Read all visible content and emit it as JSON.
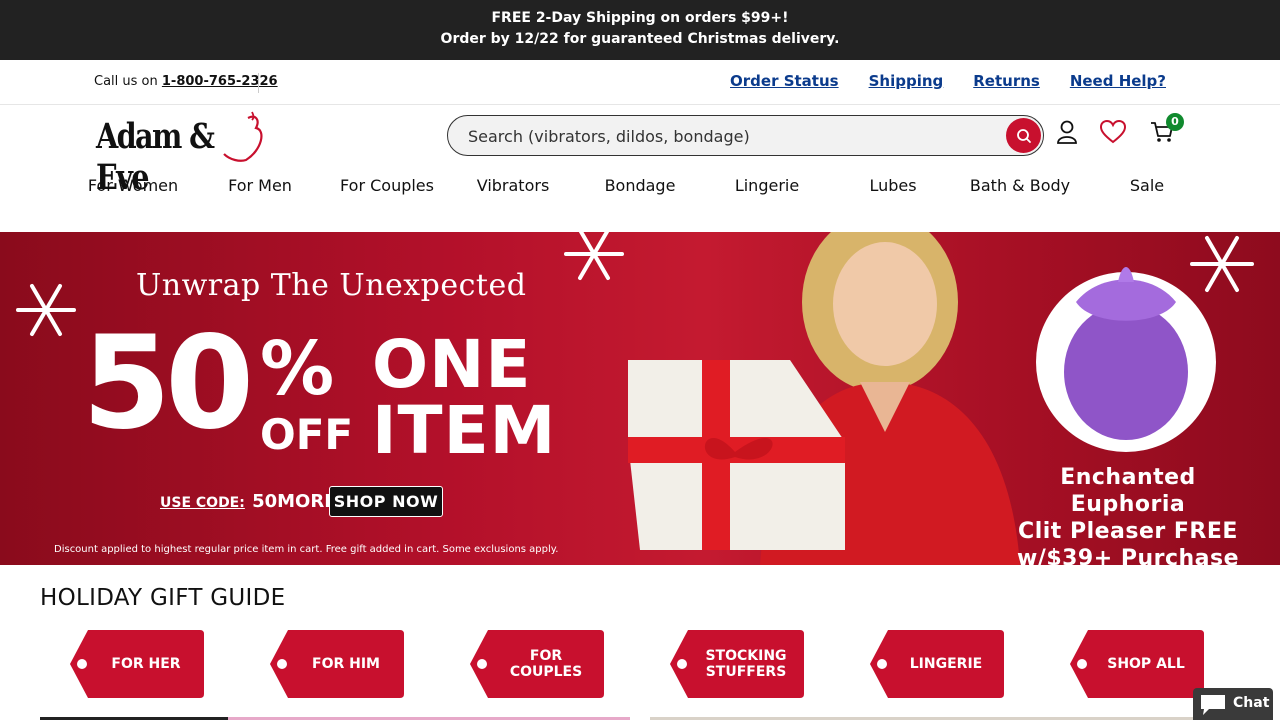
{
  "promo": {
    "line1": "FREE 2-Day Shipping on orders $99+!",
    "line2": "Order by 12/22 for guaranteed Christmas delivery."
  },
  "utility": {
    "call_prefix": "Call us on",
    "phone": "1-800-765-2326",
    "links": [
      "Order Status",
      "Shipping",
      "Returns",
      "Need Help?"
    ]
  },
  "logo": {
    "text": "Adam & Eve"
  },
  "search": {
    "placeholder": "Search (vibrators, dildos, bondage)"
  },
  "cart": {
    "count": "0"
  },
  "nav": [
    "For Women",
    "For Men",
    "For Couples",
    "Vibrators",
    "Bondage",
    "Lingerie",
    "Lubes",
    "Bath & Body",
    "Sale"
  ],
  "hero": {
    "headline": "Unwrap The Unexpected",
    "big_number": "50",
    "percent": "%",
    "off": "OFF",
    "one": "ONE",
    "item": "ITEM",
    "use_code_label": "USE CODE:",
    "code": "50MORE",
    "cta": "SHOP NOW",
    "disclaimer": "Discount applied to highest regular price item in cart. Free gift added in cart. Some exclusions apply.",
    "gift_line1": "Enchanted Euphoria",
    "gift_line2": "Clit Pleaser FREE",
    "gift_line3": "w/$39+ Purchase"
  },
  "gift_guide": {
    "title": "HOLIDAY GIFT GUIDE",
    "tags": [
      "FOR HER",
      "FOR HIM",
      "FOR COUPLES",
      "STOCKING STUFFERS",
      "LINGERIE",
      "SHOP ALL"
    ]
  },
  "chat": {
    "label": "Chat"
  },
  "colors": {
    "accent_red": "#c8102e",
    "promo_bg": "#222222",
    "link_blue": "#0b3b8c",
    "badge_green": "#108a2e"
  }
}
